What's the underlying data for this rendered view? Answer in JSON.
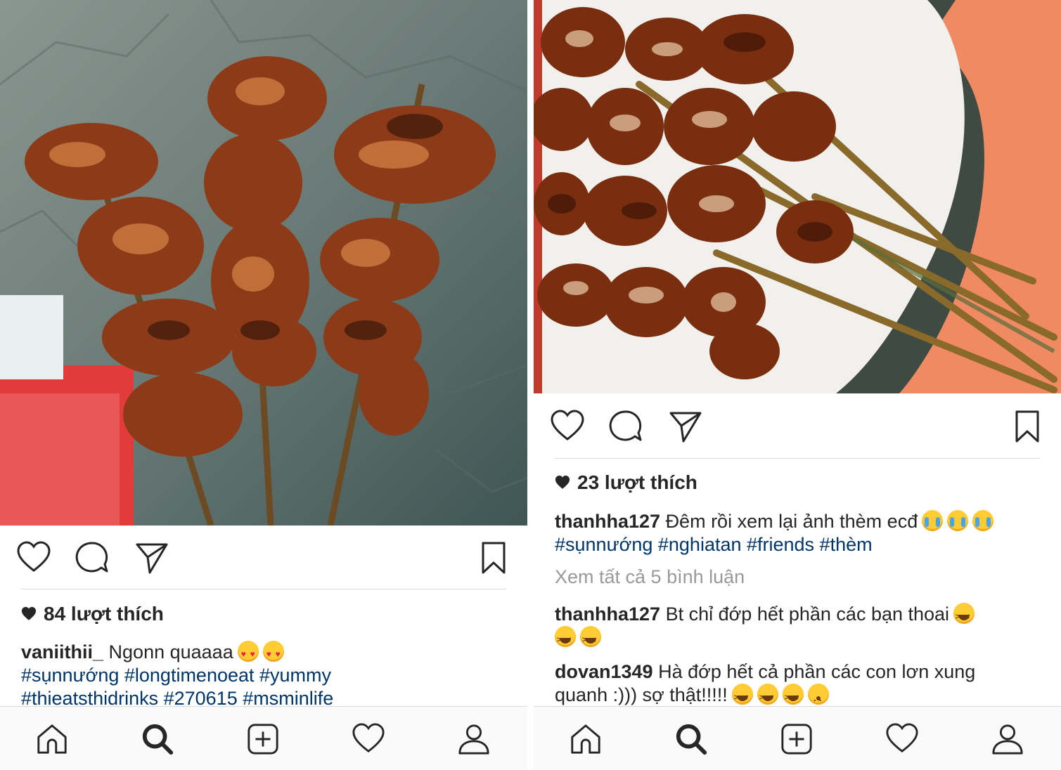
{
  "left": {
    "likes": "84 lượt thích",
    "caption": {
      "user": "vaniithii_",
      "text": "Ngonn quaaaa",
      "hashtags_line1": "#sụnnướng #longtimenoeat #yummy",
      "hashtags_line2": "#thieatsthidrinks #270615 #msminlife"
    }
  },
  "right": {
    "likes": "23 lượt thích",
    "caption": {
      "user": "thanhha127",
      "text": "Đêm rồi xem lại ảnh thèm ecđ",
      "hashtags": "#sụnnướng #nghiatan #friends #thèm"
    },
    "view_all": "Xem tất cả 5 bình luận",
    "comments": [
      {
        "user": "thanhha127",
        "text": "Bt chỉ đớp hết phần các bạn thoai"
      },
      {
        "user": "dovan1349",
        "text_line1": "Hà đớp hết cả phần các con lơn xung",
        "text_line2": "quanh :))) sợ thật!!!!!"
      }
    ]
  },
  "icons": [
    "heart-icon",
    "comment-icon",
    "share-icon",
    "bookmark-icon",
    "home-icon",
    "search-icon",
    "add-icon",
    "activity-icon",
    "profile-icon"
  ],
  "colors": {
    "hashtag": "#003569",
    "muted": "#999999",
    "text": "#262626",
    "divider": "#dbdbdb"
  }
}
